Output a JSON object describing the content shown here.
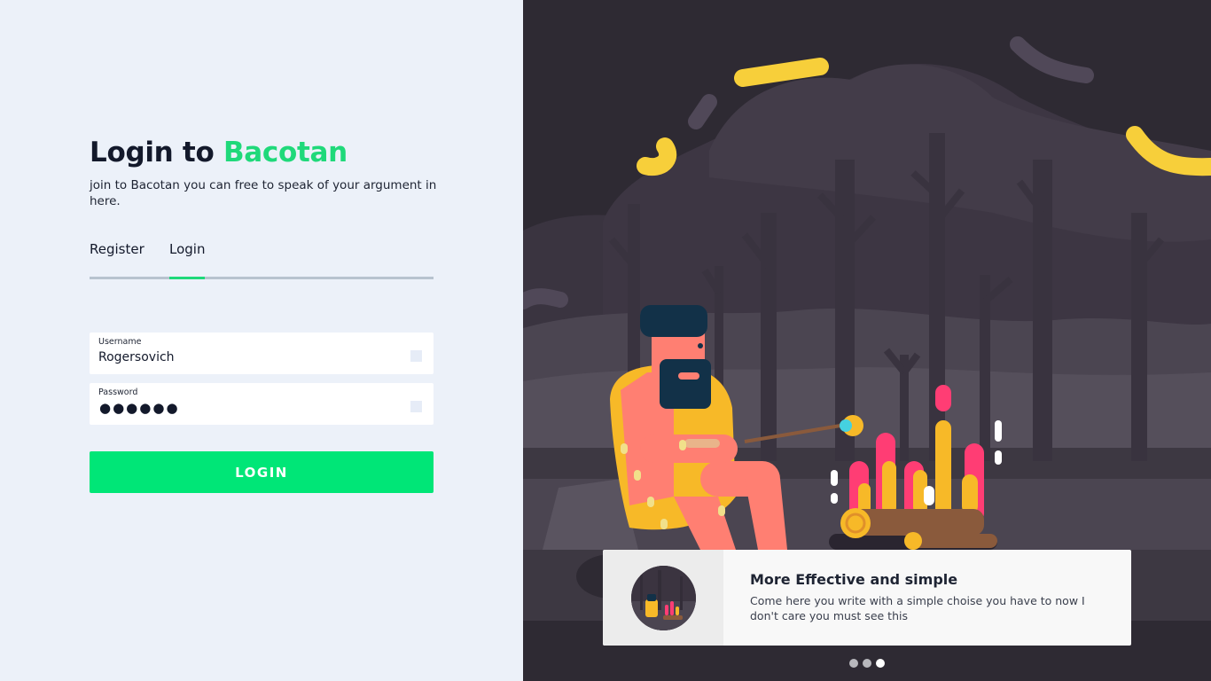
{
  "login": {
    "title_prefix": "Login to",
    "title_brand": "Bacotan",
    "subtitle": "join to Bacotan you can free to speak of your argument in here.",
    "tabs": [
      {
        "label": "Register",
        "active": false
      },
      {
        "label": "Login",
        "active": true
      }
    ],
    "username": {
      "label": "Username",
      "value": "Rogersovich"
    },
    "password": {
      "label": "Password",
      "masked_value": "●●●●●●"
    },
    "submit_label": "LOGIN"
  },
  "slide": {
    "title": "More Effective and simple",
    "text": "Come here you write with a simple choise you have to now I don't care you must see this",
    "dots": [
      {
        "active": false
      },
      {
        "active": false
      },
      {
        "active": true
      }
    ]
  },
  "colors": {
    "accent": "#00e677",
    "brand_text": "#1fd97a",
    "left_background": "#ecf1f9",
    "illustration_background": "#2e2a33"
  },
  "icons": {
    "username_field": "field-status-icon",
    "password_field": "field-status-icon"
  }
}
